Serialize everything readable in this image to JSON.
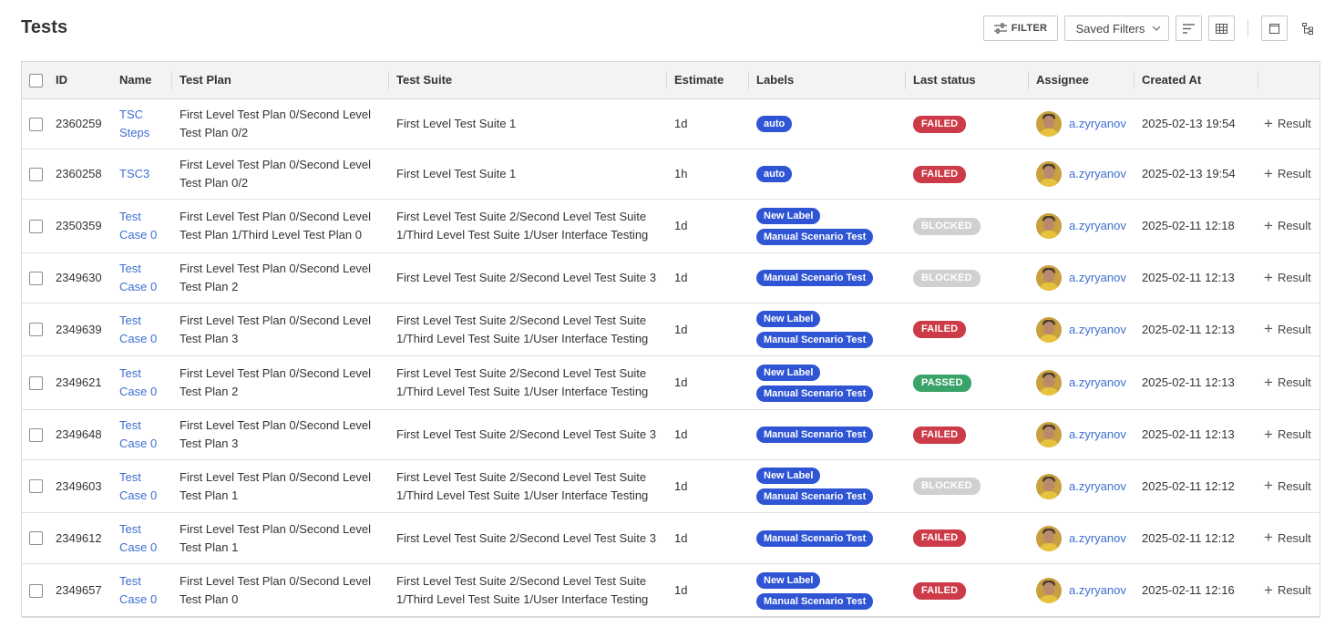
{
  "page": {
    "title": "Tests"
  },
  "toolbar": {
    "filter_label": "FILTER",
    "saved_filters_label": "Saved Filters"
  },
  "table": {
    "columns": {
      "id": "ID",
      "name": "Name",
      "test_plan": "Test Plan",
      "test_suite": "Test Suite",
      "estimate": "Estimate",
      "labels": "Labels",
      "last_status": "Last status",
      "assignee": "Assignee",
      "created_at": "Created At"
    },
    "result_label": "Result",
    "rows": [
      {
        "id": "2360259",
        "name": "TSC Steps",
        "test_plan": "First Level Test Plan 0/Second Level Test Plan 0/2",
        "test_suite": "First Level Test Suite 1",
        "estimate": "1d",
        "labels": [
          "auto"
        ],
        "status": "FAILED",
        "assignee": "a.zyryanov",
        "created_at": "2025-02-13 19:54"
      },
      {
        "id": "2360258",
        "name": "TSC3",
        "test_plan": "First Level Test Plan 0/Second Level Test Plan 0/2",
        "test_suite": "First Level Test Suite 1",
        "estimate": "1h",
        "labels": [
          "auto"
        ],
        "status": "FAILED",
        "assignee": "a.zyryanov",
        "created_at": "2025-02-13 19:54"
      },
      {
        "id": "2350359",
        "name": "Test Case 0",
        "test_plan": "First Level Test Plan 0/Second Level Test Plan 1/Third Level Test Plan 0",
        "test_suite": "First Level Test Suite 2/Second Level Test Suite 1/Third Level Test Suite 1/User Interface Testing",
        "estimate": "1d",
        "labels": [
          "New Label",
          "Manual Scenario Test"
        ],
        "status": "BLOCKED",
        "assignee": "a.zyryanov",
        "created_at": "2025-02-11 12:18"
      },
      {
        "id": "2349630",
        "name": "Test Case 0",
        "test_plan": "First Level Test Plan 0/Second Level Test Plan 2",
        "test_suite": "First Level Test Suite 2/Second Level Test Suite 3",
        "estimate": "1d",
        "labels": [
          "Manual Scenario Test"
        ],
        "status": "BLOCKED",
        "assignee": "a.zyryanov",
        "created_at": "2025-02-11 12:13"
      },
      {
        "id": "2349639",
        "name": "Test Case 0",
        "test_plan": "First Level Test Plan 0/Second Level Test Plan 3",
        "test_suite": "First Level Test Suite 2/Second Level Test Suite 1/Third Level Test Suite 1/User Interface Testing",
        "estimate": "1d",
        "labels": [
          "New Label",
          "Manual Scenario Test"
        ],
        "status": "FAILED",
        "assignee": "a.zyryanov",
        "created_at": "2025-02-11 12:13"
      },
      {
        "id": "2349621",
        "name": "Test Case 0",
        "test_plan": "First Level Test Plan 0/Second Level Test Plan 2",
        "test_suite": "First Level Test Suite 2/Second Level Test Suite 1/Third Level Test Suite 1/User Interface Testing",
        "estimate": "1d",
        "labels": [
          "New Label",
          "Manual Scenario Test"
        ],
        "status": "PASSED",
        "assignee": "a.zyryanov",
        "created_at": "2025-02-11 12:13"
      },
      {
        "id": "2349648",
        "name": "Test Case 0",
        "test_plan": "First Level Test Plan 0/Second Level Test Plan 3",
        "test_suite": "First Level Test Suite 2/Second Level Test Suite 3",
        "estimate": "1d",
        "labels": [
          "Manual Scenario Test"
        ],
        "status": "FAILED",
        "assignee": "a.zyryanov",
        "created_at": "2025-02-11 12:13"
      },
      {
        "id": "2349603",
        "name": "Test Case 0",
        "test_plan": "First Level Test Plan 0/Second Level Test Plan 1",
        "test_suite": "First Level Test Suite 2/Second Level Test Suite 1/Third Level Test Suite 1/User Interface Testing",
        "estimate": "1d",
        "labels": [
          "New Label",
          "Manual Scenario Test"
        ],
        "status": "BLOCKED",
        "assignee": "a.zyryanov",
        "created_at": "2025-02-11 12:12"
      },
      {
        "id": "2349612",
        "name": "Test Case 0",
        "test_plan": "First Level Test Plan 0/Second Level Test Plan 1",
        "test_suite": "First Level Test Suite 2/Second Level Test Suite 3",
        "estimate": "1d",
        "labels": [
          "Manual Scenario Test"
        ],
        "status": "FAILED",
        "assignee": "a.zyryanov",
        "created_at": "2025-02-11 12:12"
      },
      {
        "id": "2349657",
        "name": "Test Case 0",
        "test_plan": "First Level Test Plan 0/Second Level Test Plan 0",
        "test_suite": "First Level Test Suite 2/Second Level Test Suite 1/Third Level Test Suite 1/User Interface Testing",
        "estimate": "1d",
        "labels": [
          "New Label",
          "Manual Scenario Test"
        ],
        "status": "FAILED",
        "assignee": "a.zyryanov",
        "created_at": "2025-02-11 12:16"
      }
    ]
  },
  "colors": {
    "label": "#2f55d4",
    "link": "#3d6fd1",
    "status_failed": "#cc3b47",
    "status_blocked": "#d0d0d0",
    "status_passed": "#3aa36a"
  },
  "icons": {
    "filter": "sliders-icon",
    "saved_filters_chevron": "chevron-down-icon",
    "sort": "sort-icon",
    "columns": "table-grid-icon",
    "panel": "panel-icon",
    "tree": "tree-icon",
    "result": "plus-icon"
  }
}
